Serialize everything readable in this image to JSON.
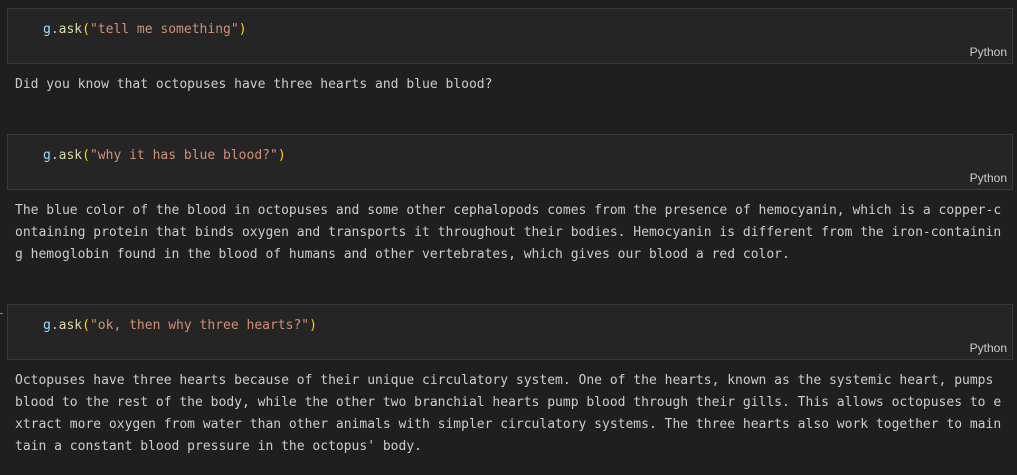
{
  "cells": [
    {
      "code": {
        "obj": "g",
        "dot": ".",
        "method": "ask",
        "open": "(",
        "arg": "\"tell me something\"",
        "close": ")"
      },
      "language": "Python",
      "output": "Did you know that octopuses have three hearts and blue blood?"
    },
    {
      "code": {
        "obj": "g",
        "dot": ".",
        "method": "ask",
        "open": "(",
        "arg": "\"why it has blue blood?\"",
        "close": ")"
      },
      "language": "Python",
      "output": "The blue color of the blood in octopuses and some other cephalopods comes from the presence of hemocyanin, which is a copper-containing protein that binds oxygen and transports it throughout their bodies. Hemocyanin is different from the iron-containing hemoglobin found in the blood of humans and other vertebrates, which gives our blood a red color."
    },
    {
      "code": {
        "obj": "g",
        "dot": ".",
        "method": "ask",
        "open": "(",
        "arg": "\"ok, then why three hearts?\"",
        "close": ")"
      },
      "language": "Python",
      "output": "Octopuses have three hearts because of their unique circulatory system. One of the hearts, known as the systemic heart, pumps blood to the rest of the body, while the other two branchial hearts pump blood through their gills. This allows octopuses to extract more oxygen from water than other animals with simpler circulatory systems. The three hearts also work together to maintain a constant blood pressure in the octopus' body."
    }
  ]
}
